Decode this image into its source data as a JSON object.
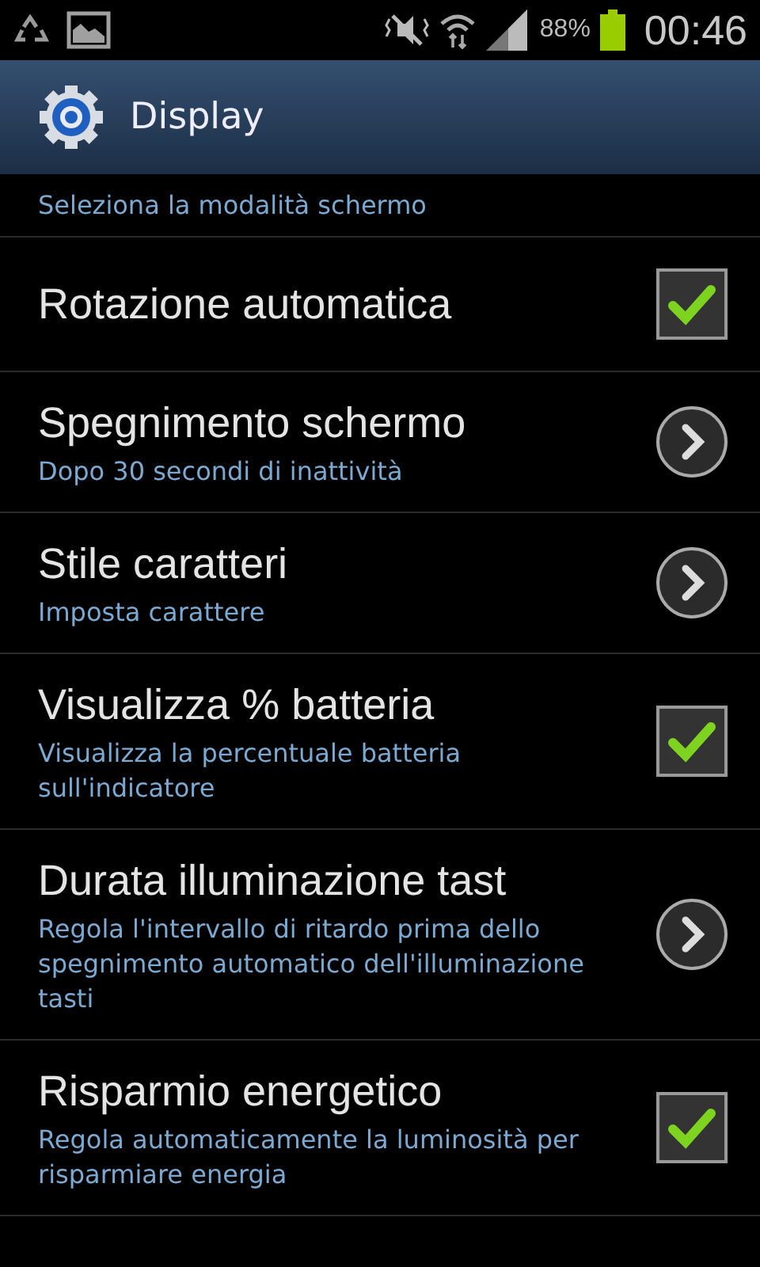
{
  "status_bar": {
    "battery_text": "88%",
    "time": "00:46"
  },
  "action_bar": {
    "title": "Display"
  },
  "header_summary": "Seleziona la modalità schermo",
  "settings": [
    {
      "kind": "checkbox",
      "title": "Rotazione automatica",
      "checked": true
    },
    {
      "kind": "arrow",
      "title": "Spegnimento schermo",
      "summary": "Dopo 30 secondi di inattività"
    },
    {
      "kind": "arrow",
      "title": "Stile caratteri",
      "summary": "Imposta carattere"
    },
    {
      "kind": "checkbox",
      "title": "Visualizza % batteria",
      "summary": "Visualizza la percentuale batteria sull'indicatore",
      "checked": true
    },
    {
      "kind": "arrow",
      "title": "Durata illuminazione tast",
      "summary": "Regola l'intervallo di ritardo prima dello spegnimento automatico dell'illuminazione tasti"
    },
    {
      "kind": "checkbox",
      "title": "Risparmio energetico",
      "summary": "Regola automaticamente la luminosità per risparmiare energia",
      "checked": true
    }
  ]
}
